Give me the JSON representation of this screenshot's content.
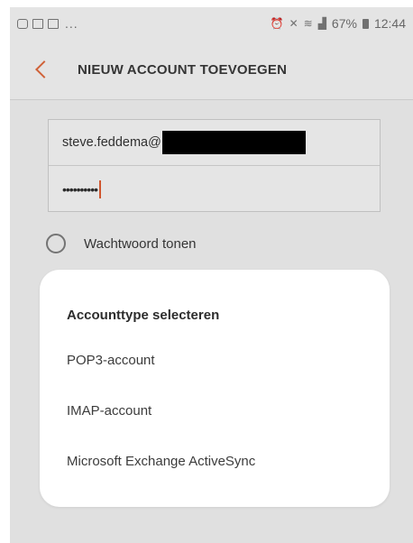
{
  "statusbar": {
    "dots": "...",
    "battery": "67%",
    "time": "12:44"
  },
  "header": {
    "title": "NIEUW ACCOUNT TOEVOEGEN"
  },
  "form": {
    "email_value": "steve.feddema@",
    "password_value": "••••••••••"
  },
  "show_password": {
    "label": "Wachtwoord tonen"
  },
  "dialog": {
    "title": "Accounttype selecteren",
    "options": [
      "POP3-account",
      "IMAP-account",
      "Microsoft Exchange ActiveSync"
    ]
  },
  "colors": {
    "accent": "#e06a3d",
    "dim_background": "#e8e8e8",
    "dialog_background": "#ffffff"
  }
}
